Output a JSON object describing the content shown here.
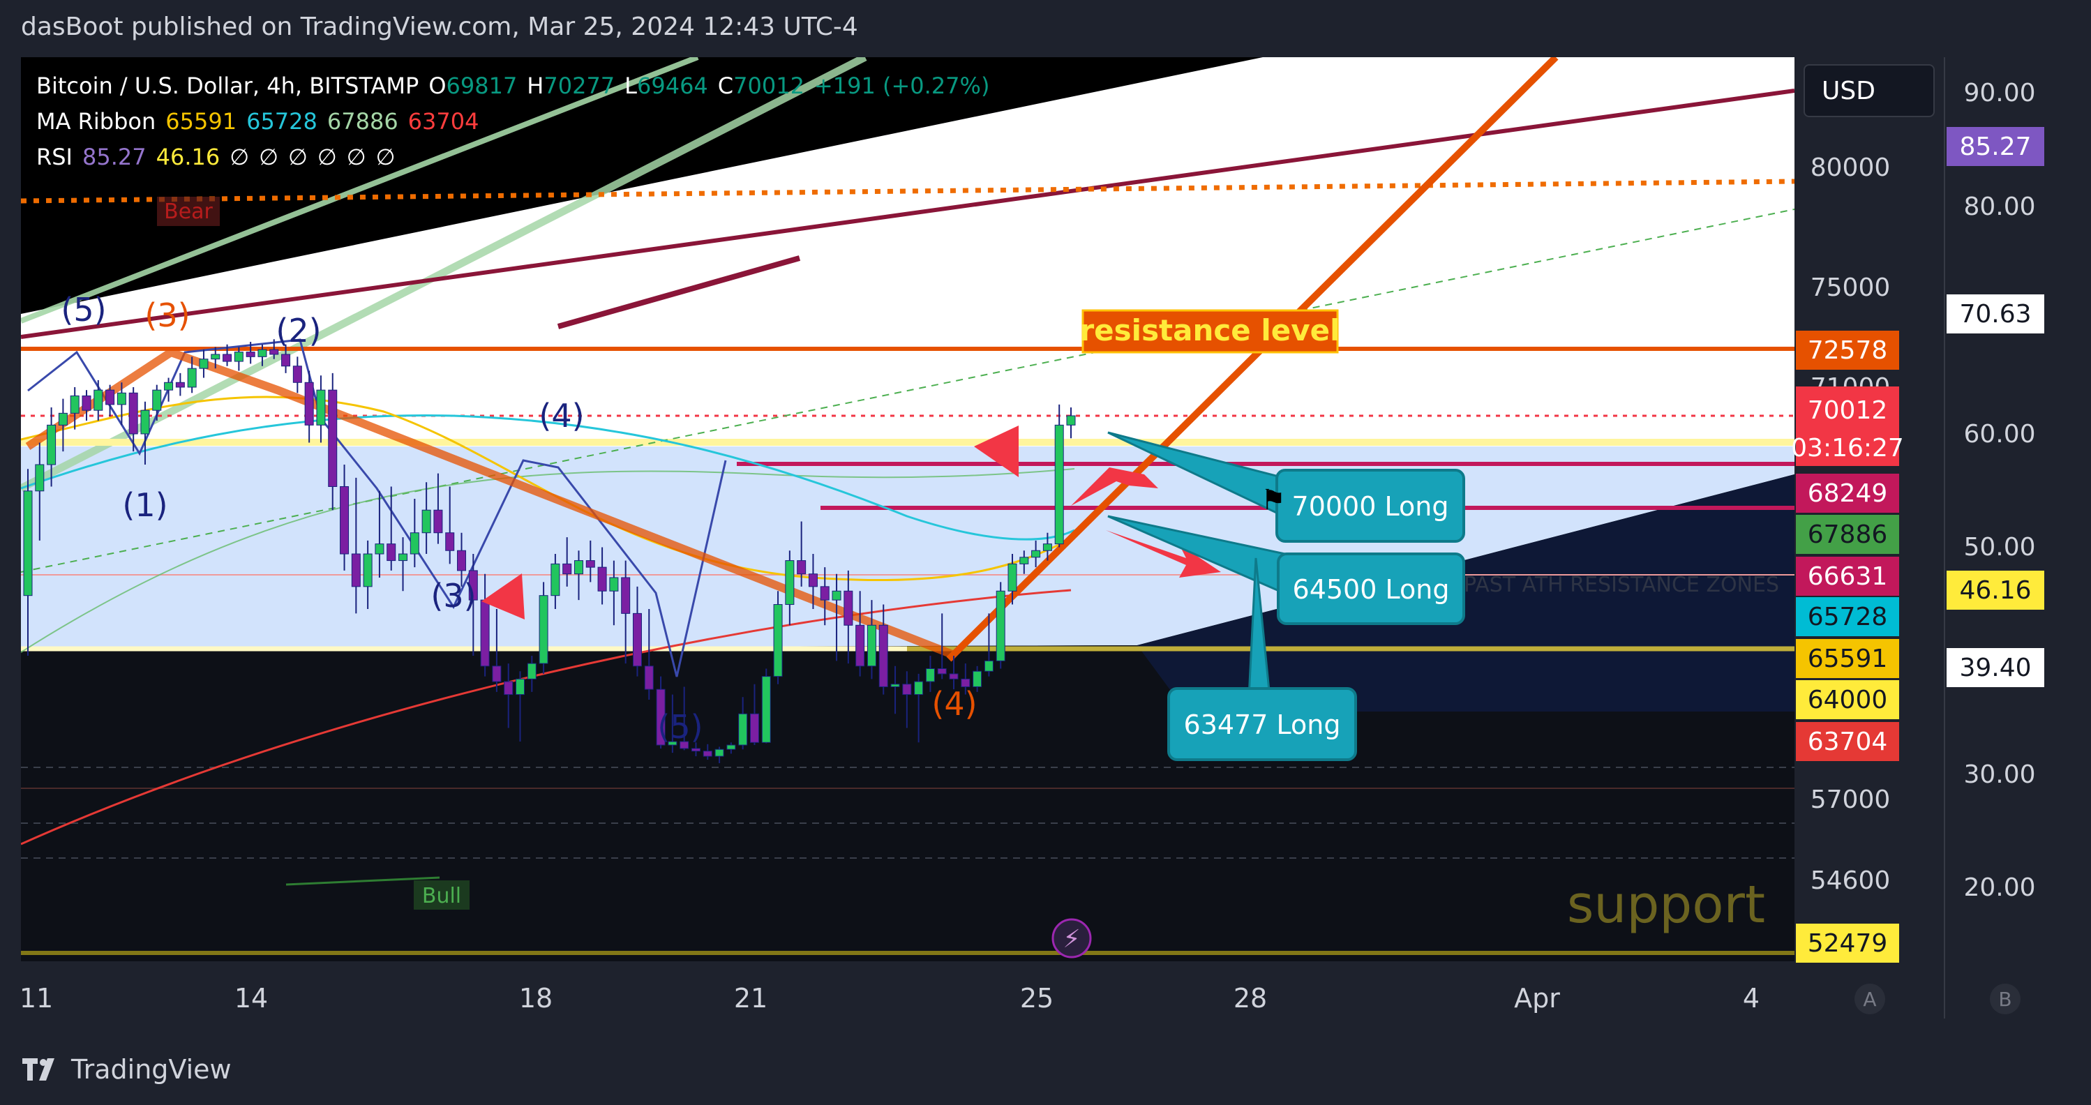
{
  "header": {
    "publisher": "dasBoot published on TradingView.com, Mar 25, 2024 12:43 UTC-4"
  },
  "legend": {
    "symbol": "Bitcoin / U.S. Dollar, 4h, BITSTAMP",
    "o_label": "O",
    "o_value": "69817",
    "h_label": "H",
    "h_value": "70277",
    "l_label": "L",
    "l_value": "69464",
    "c_label": "C",
    "c_value": "70012",
    "change": "+191 (+0.27%)",
    "ma_label": "MA Ribbon",
    "ma_values": [
      "65591",
      "65728",
      "67886",
      "63704"
    ],
    "ma_colors": [
      "#f5c400",
      "#26c6da",
      "#a5d6a7",
      "#ff3d3d"
    ],
    "rsi_label": "RSI",
    "rsi_values": [
      "85.27",
      "46.16"
    ],
    "rsi_empty": [
      "∅",
      "∅",
      "∅",
      "∅",
      "∅",
      "∅"
    ]
  },
  "currency": "USD",
  "chart_data": {
    "type": "candlestick",
    "title": "Bitcoin / U.S. Dollar, 4h, BITSTAMP",
    "x_ticks": [
      "11",
      "14",
      "18",
      "21",
      "25",
      "28",
      "Apr",
      "4"
    ],
    "price_axis_ticks": [
      "80000",
      "75000",
      "71000",
      "57000",
      "54600"
    ],
    "price_axis_tags": [
      {
        "label": "72578",
        "color": "#e65100"
      },
      {
        "label": "70012",
        "sublabel": "03:16:27",
        "color": "#f23645"
      },
      {
        "label": "68249",
        "color": "#c2185b"
      },
      {
        "label": "67886",
        "color": "#43a047"
      },
      {
        "label": "66631",
        "color": "#c2185b"
      },
      {
        "label": "65728",
        "color": "#00bcd4"
      },
      {
        "label": "65591",
        "color": "#f5c400"
      },
      {
        "label": "64000",
        "color": "#ffeb3b"
      },
      {
        "label": "63704",
        "color": "#e53935"
      },
      {
        "label": "52479",
        "color": "#ffeb3b"
      }
    ],
    "rsi_axis_ticks": [
      "90.00",
      "80.00",
      "60.00",
      "50.00",
      "30.00",
      "20.00"
    ],
    "rsi_axis_tags": [
      {
        "label": "85.27",
        "color": "#7e57c2"
      },
      {
        "label": "70.63",
        "color": "#ffffff"
      },
      {
        "label": "46.16",
        "color": "#ffeb3b"
      },
      {
        "label": "39.40",
        "color": "#ffffff"
      }
    ],
    "annotations": {
      "resistance": "resistance level",
      "support": "support",
      "zone": "PAST ATH RESISTANCE ZONES",
      "bear": "Bear",
      "bull": "Bull",
      "callouts": [
        "70000 Long",
        "64500 Long",
        "63477 Long"
      ],
      "waves": [
        "(5)",
        "(3)",
        "(2)",
        "(1)",
        "(4)",
        "(3)",
        "(5)",
        "(4)"
      ]
    },
    "candles": [
      [
        66200,
        68800,
        65600,
        68300
      ],
      [
        68300,
        69400,
        67700,
        68900
      ],
      [
        68900,
        70300,
        68400,
        69800
      ],
      [
        69800,
        70600,
        69200,
        70100
      ],
      [
        70100,
        71000,
        69700,
        70700
      ],
      [
        70700,
        70900,
        69900,
        70200
      ],
      [
        70200,
        71300,
        69900,
        70900
      ],
      [
        70900,
        71100,
        70000,
        70400
      ],
      [
        70400,
        71200,
        69800,
        70800
      ],
      [
        70800,
        71000,
        69200,
        69600
      ],
      [
        69600,
        70500,
        68900,
        70200
      ],
      [
        70200,
        71100,
        69900,
        70900
      ],
      [
        70900,
        71400,
        70500,
        71200
      ],
      [
        71200,
        71600,
        70700,
        71000
      ],
      [
        71000,
        72300,
        70800,
        71800
      ],
      [
        71800,
        72600,
        71400,
        72200
      ],
      [
        72200,
        72700,
        71800,
        72400
      ],
      [
        72400,
        72800,
        71900,
        72100
      ],
      [
        72100,
        72700,
        71700,
        72500
      ],
      [
        72500,
        72900,
        72000,
        72300
      ],
      [
        72300,
        72800,
        71900,
        72600
      ],
      [
        72600,
        73000,
        72200,
        72400
      ],
      [
        72400,
        72800,
        71600,
        71900
      ],
      [
        71900,
        72300,
        70800,
        71200
      ],
      [
        71200,
        71700,
        69400,
        69800
      ],
      [
        69800,
        71500,
        69400,
        70900
      ],
      [
        70900,
        71600,
        68100,
        68400
      ],
      [
        68400,
        68900,
        66800,
        67300
      ],
      [
        67300,
        68600,
        65800,
        66400
      ],
      [
        66400,
        67700,
        65900,
        67300
      ],
      [
        67300,
        68300,
        66600,
        67600
      ],
      [
        67600,
        68400,
        66800,
        67100
      ],
      [
        67100,
        67800,
        66300,
        67300
      ],
      [
        67300,
        68200,
        66900,
        67900
      ],
      [
        67900,
        68500,
        67300,
        68100
      ],
      [
        68100,
        68700,
        67600,
        67900
      ],
      [
        67900,
        68400,
        67000,
        67400
      ],
      [
        67400,
        67900,
        66400,
        66800
      ],
      [
        66800,
        67300,
        65600,
        66100
      ],
      [
        66100,
        66700,
        64900,
        65300
      ],
      [
        65300,
        65900,
        64300,
        64700
      ],
      [
        64700,
        65400,
        63800,
        64200
      ],
      [
        64200,
        65100,
        63700,
        64800
      ],
      [
        64800,
        65600,
        64300,
        65400
      ],
      [
        65400,
        66500,
        65000,
        66200
      ],
      [
        66200,
        67300,
        65900,
        67000
      ],
      [
        67000,
        67800,
        66400,
        66700
      ],
      [
        66700,
        67400,
        66100,
        67100
      ],
      [
        67100,
        67700,
        66500,
        66900
      ],
      [
        66900,
        67500,
        66000,
        66300
      ],
      [
        66300,
        67100,
        65700,
        66600
      ],
      [
        66600,
        67100,
        65400,
        65800
      ],
      [
        65800,
        66400,
        64900,
        65300
      ],
      [
        65300,
        65900,
        64000,
        64400
      ],
      [
        64400,
        64900,
        62900,
        63300
      ],
      [
        63300,
        64200,
        62400,
        63700
      ],
      [
        63700,
        64500,
        62700,
        62900
      ],
      [
        62900,
        63600,
        62000,
        62600
      ],
      [
        62600,
        63400,
        61600,
        62000
      ],
      [
        62000,
        63100,
        61200,
        62800
      ],
      [
        62800,
        63600,
        62300,
        63300
      ],
      [
        63300,
        64100,
        62800,
        63900
      ],
      [
        63900,
        64600,
        63300,
        63600
      ],
      [
        63600,
        65200,
        63500,
        64900
      ],
      [
        64900,
        66300,
        64600,
        66000
      ],
      [
        66000,
        67400,
        65700,
        67100
      ],
      [
        67100,
        68000,
        66400,
        66700
      ],
      [
        66700,
        67300,
        65900,
        66400
      ],
      [
        66400,
        66900,
        65700,
        66100
      ],
      [
        66100,
        66700,
        65500,
        66300
      ],
      [
        66300,
        66800,
        65400,
        65700
      ],
      [
        65700,
        66300,
        64900,
        65300
      ],
      [
        65300,
        66100,
        64800,
        65700
      ],
      [
        65700,
        66000,
        64200,
        64500
      ],
      [
        64500,
        65300,
        63900,
        64600
      ],
      [
        64600,
        65100,
        63800,
        64200
      ],
      [
        64200,
        65000,
        63600,
        64700
      ],
      [
        64700,
        65600,
        64300,
        65200
      ],
      [
        65200,
        65800,
        64800,
        65000
      ],
      [
        65000,
        65600,
        64400,
        64800
      ],
      [
        64800,
        65400,
        64200,
        64500
      ],
      [
        64500,
        65300,
        64300,
        65100
      ],
      [
        65100,
        65800,
        64900,
        65500
      ],
      [
        65500,
        66500,
        65200,
        66300
      ],
      [
        66300,
        67300,
        66000,
        67000
      ],
      [
        67000,
        67400,
        66700,
        67200
      ],
      [
        67200,
        67700,
        66900,
        67400
      ],
      [
        67400,
        67900,
        67100,
        67600
      ],
      [
        67600,
        70400,
        67500,
        69800
      ],
      [
        69800,
        70300,
        69500,
        70012
      ]
    ]
  }
}
